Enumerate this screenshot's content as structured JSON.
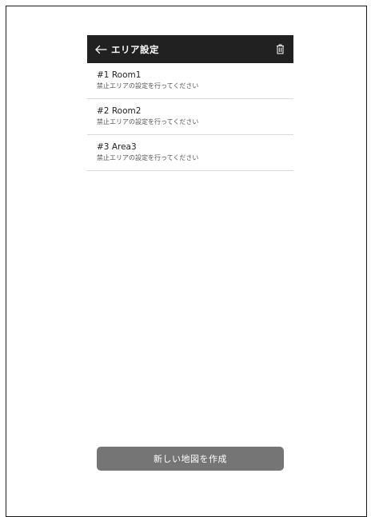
{
  "app_bar": {
    "title": "エリア設定",
    "back_icon": "arrow-left-icon",
    "trash_icon": "trash-icon"
  },
  "areas": [
    {
      "title": "#1 Room1",
      "subtitle": "禁止エリアの設定を行ってください"
    },
    {
      "title": "#2 Room2",
      "subtitle": "禁止エリアの設定を行ってください"
    },
    {
      "title": "#3 Area3",
      "subtitle": "禁止エリアの設定を行ってください"
    }
  ],
  "create_button": {
    "label": "新しい地図を作成"
  },
  "colors": {
    "app_bar_bg": "#212121",
    "button_bg": "#757575",
    "divider": "#d9d9d9"
  }
}
